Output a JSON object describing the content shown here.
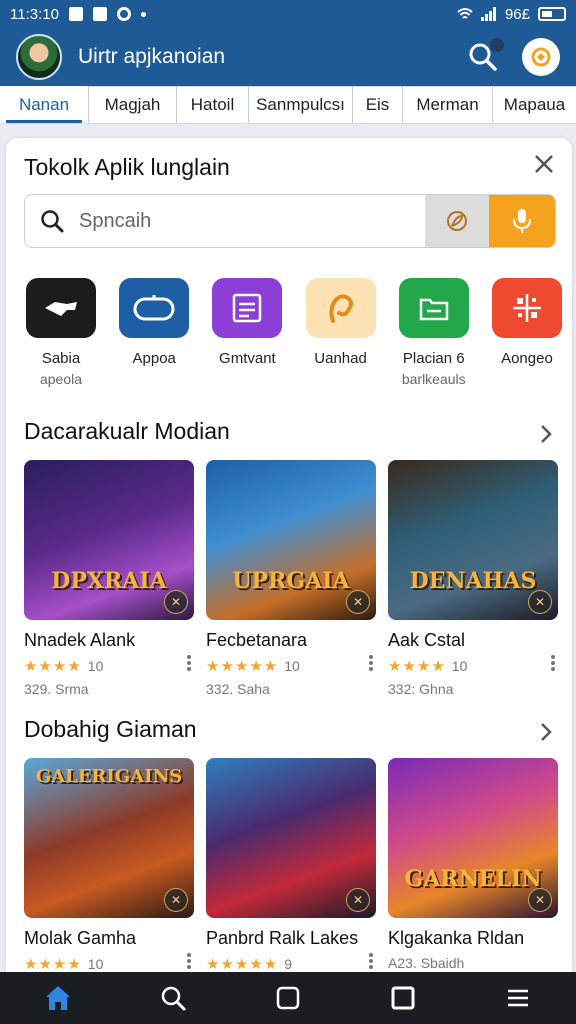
{
  "status_bar": {
    "time": "11:3:10",
    "signal": "96£"
  },
  "app_bar": {
    "title": "Uirtr apjkanoian"
  },
  "tabs": [
    {
      "label": "Nanan",
      "active": true
    },
    {
      "label": "Magjah"
    },
    {
      "label": "Hatoil"
    },
    {
      "label": "Sanmpulcsı"
    },
    {
      "label": "Eis"
    },
    {
      "label": "Merman"
    },
    {
      "label": "Mapaua"
    }
  ],
  "sheet": {
    "title": "Tokolk Aplik lunglain",
    "search_placeholder": "Spncaih"
  },
  "categories": [
    {
      "label": "Sabia",
      "sub": "apeola",
      "color": "#1c1c1c",
      "icon": "controller-icon"
    },
    {
      "label": "Appoa",
      "sub": "",
      "color": "#1d5ea4",
      "icon": "gamepad-icon"
    },
    {
      "label": "Gmtvant",
      "sub": "",
      "color": "#8b3fd6",
      "icon": "grid-icon"
    },
    {
      "label": "Uanhad",
      "sub": "",
      "color": "#fde3b4",
      "icon": "magnet-icon"
    },
    {
      "label": "Placian 6",
      "sub": "barlkeauls",
      "color": "#22a84a",
      "icon": "folder-icon"
    },
    {
      "label": "Aongeo",
      "sub": "",
      "color": "#ef4a2f",
      "icon": "puzzle-icon"
    }
  ],
  "section1": {
    "title": "Dacarakualr Modian",
    "games": [
      {
        "name": "Nnadek Alank",
        "rating": "10",
        "size": "329. Srma",
        "logo": "DPXRAIA",
        "bg": "linear-gradient(160deg,#2a1e5c 0%,#5b2a8c 45%,#a64fc8 75%,#2a1a3e 100%)"
      },
      {
        "name": "Fecbetanara",
        "rating": "10",
        "size": "332. Saha",
        "logo": "UPRGAIA",
        "bg": "linear-gradient(160deg,#1e5fa8 0%,#3f8ed0 40%,#c66e28 75%,#2a1a10 100%)"
      },
      {
        "name": "Aak Cstal",
        "rating": "10",
        "size": "332: Ghna",
        "logo": "DENAHAS",
        "bg": "linear-gradient(160deg,#3a2a1c 0%,#2f5f78 40%,#4b6a82 70%,#1c1c24 100%)"
      }
    ]
  },
  "section2": {
    "title": "Dobahig Giaman",
    "games": [
      {
        "name": "Molak Gamha",
        "rating": "10",
        "size": "",
        "logo": "GALERIGAINS",
        "bg": "linear-gradient(160deg,#5aa8d8 0%,#8d3a28 45%,#c85a22 70%,#2a1a14 100%)"
      },
      {
        "name": "Panbrd Ralk Lakes",
        "rating": "9",
        "size": "",
        "logo": "",
        "bg": "linear-gradient(160deg,#2f7fbf 0%,#4a2a6e 40%,#c22a3a 70%,#1a1a2a 100%)"
      },
      {
        "name": "Klgakanka Rldan",
        "rating": "",
        "size": "A23. Sbaidh",
        "logo": "GARNELIN",
        "bg": "linear-gradient(160deg,#7a2ab8 0%,#d04a8a 40%,#e8862a 70%,#2a1430 100%)"
      }
    ]
  },
  "bottom_nav": [
    {
      "icon": "home-icon",
      "active": true
    },
    {
      "icon": "search-icon"
    },
    {
      "icon": "square-icon"
    },
    {
      "icon": "square-filled-icon"
    },
    {
      "icon": "menu-icon"
    }
  ],
  "colors": {
    "primary": "#1e5a96",
    "accent": "#f5a21e",
    "star": "#f0a531"
  }
}
